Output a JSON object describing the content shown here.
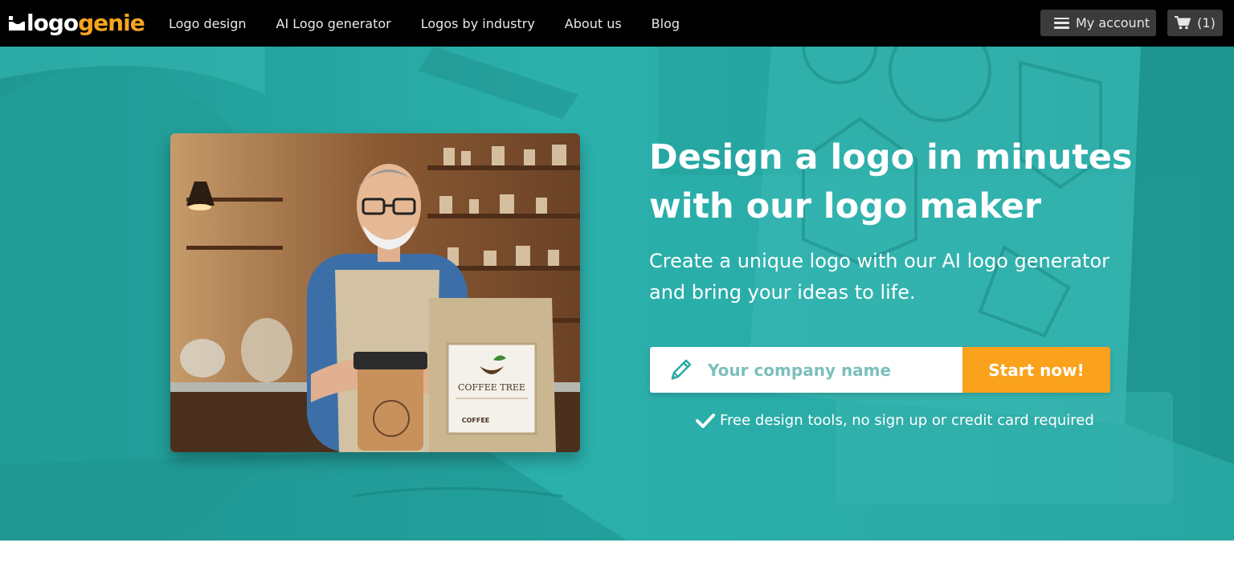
{
  "brand": {
    "name_part1": "logo",
    "name_part2": "genie",
    "accent_color": "#f7a51e"
  },
  "nav": {
    "items": [
      {
        "label": "Logo design"
      },
      {
        "label": "AI Logo generator"
      },
      {
        "label": "Logos by industry"
      },
      {
        "label": "About us"
      },
      {
        "label": "Blog"
      }
    ]
  },
  "header": {
    "account_label": "My account",
    "account_icon": "menu-icon",
    "cart_label": "(1)",
    "cart_icon": "cart-icon"
  },
  "hero": {
    "background_color": "#2aa9a6",
    "headline": "Design a logo in minutes with our logo maker",
    "subline": "Create a unique logo with our AI logo generator and bring your ideas to life.",
    "input_placeholder": "Your company name",
    "input_value": "",
    "input_icon": "pencil-icon",
    "cta_label": "Start now!",
    "cta_color": "#faa21b",
    "note": "Free design tools, no sign up or credit card required",
    "note_icon": "check-icon",
    "photo_texts": {
      "bag_brand": "COFFEE TREE",
      "bag_product": "COFFEE"
    }
  }
}
